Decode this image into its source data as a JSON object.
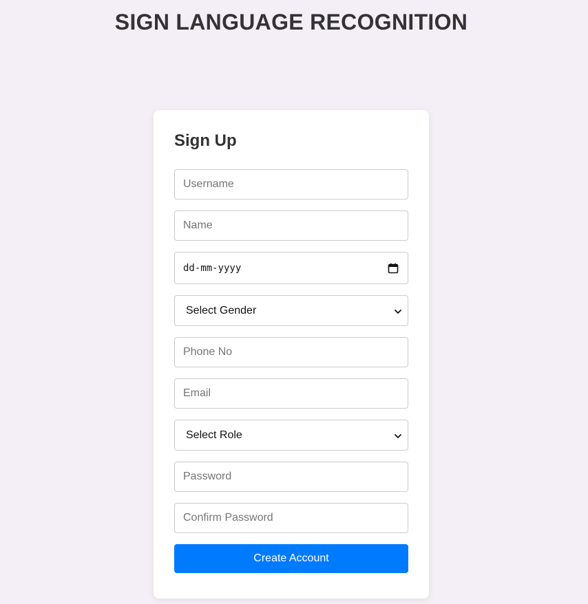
{
  "app": {
    "title": "SIGN LANGUAGE RECOGNITION"
  },
  "form": {
    "title": "Sign Up",
    "username": {
      "placeholder": "Username",
      "value": ""
    },
    "name": {
      "placeholder": "Name",
      "value": ""
    },
    "dob": {
      "display": "dd-mm-yyyy",
      "icon": "calendar-icon"
    },
    "gender": {
      "selected": "Select Gender",
      "icon": "chevron-down-icon"
    },
    "phone": {
      "placeholder": "Phone No",
      "value": ""
    },
    "email": {
      "placeholder": "Email",
      "value": ""
    },
    "role": {
      "selected": "Select Role",
      "icon": "chevron-down-icon"
    },
    "password": {
      "placeholder": "Password",
      "value": ""
    },
    "confirm_password": {
      "placeholder": "Confirm Password",
      "value": ""
    },
    "submit_label": "Create Account"
  },
  "colors": {
    "background": "#f4eff6",
    "card": "#ffffff",
    "accent": "#007bff",
    "text": "#333333",
    "border": "#cccccc"
  }
}
